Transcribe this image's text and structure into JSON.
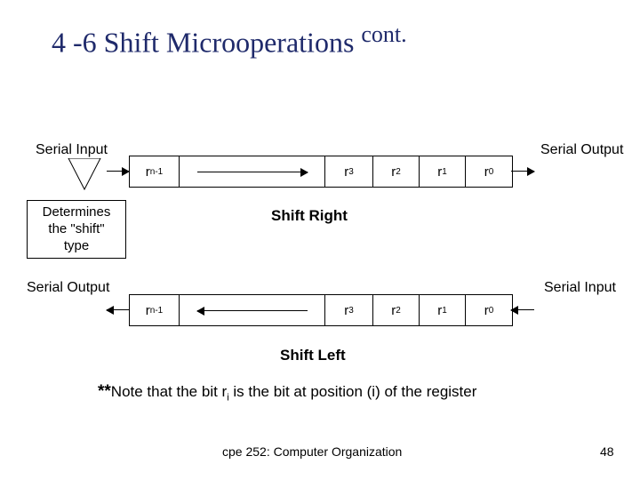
{
  "title": {
    "main": "4 -6 Shift Microoperations ",
    "sup": "cont."
  },
  "labels": {
    "serial_input": "Serial Input",
    "serial_output": "Serial Output",
    "determines": "Determines\nthe \"shift\"\ntype",
    "shift_right": "Shift Right",
    "shift_left": "Shift Left"
  },
  "cells": {
    "rn1_a": "r",
    "rn1_b": "n-1",
    "r3_a": "r",
    "r3_b": "3",
    "r2_a": "r",
    "r2_b": "2",
    "r1_a": "r",
    "r1_b": "1",
    "r0_a": "r",
    "r0_b": "0"
  },
  "note": {
    "prefix": "**",
    "text1": "Note that the bit  r",
    "sub": "i",
    "text2": "  is the bit at position (i) of the register"
  },
  "footer": "cpe 252: Computer Organization",
  "page": "48",
  "chart_data": {
    "type": "diagram",
    "rows": [
      {
        "left_label": "Serial Input",
        "cells": [
          "r_{n-1}",
          "r_3",
          "r_2",
          "r_1",
          "r_0"
        ],
        "right_label": "Serial Output",
        "caption": "Shift Right",
        "arrow": "right"
      },
      {
        "left_label": "Serial Output",
        "cells": [
          "r_{n-1}",
          "r_3",
          "r_2",
          "r_1",
          "r_0"
        ],
        "right_label": "Serial Input",
        "caption": "Shift Left",
        "arrow": "left"
      }
    ],
    "callout": "Determines the \"shift\" type"
  }
}
